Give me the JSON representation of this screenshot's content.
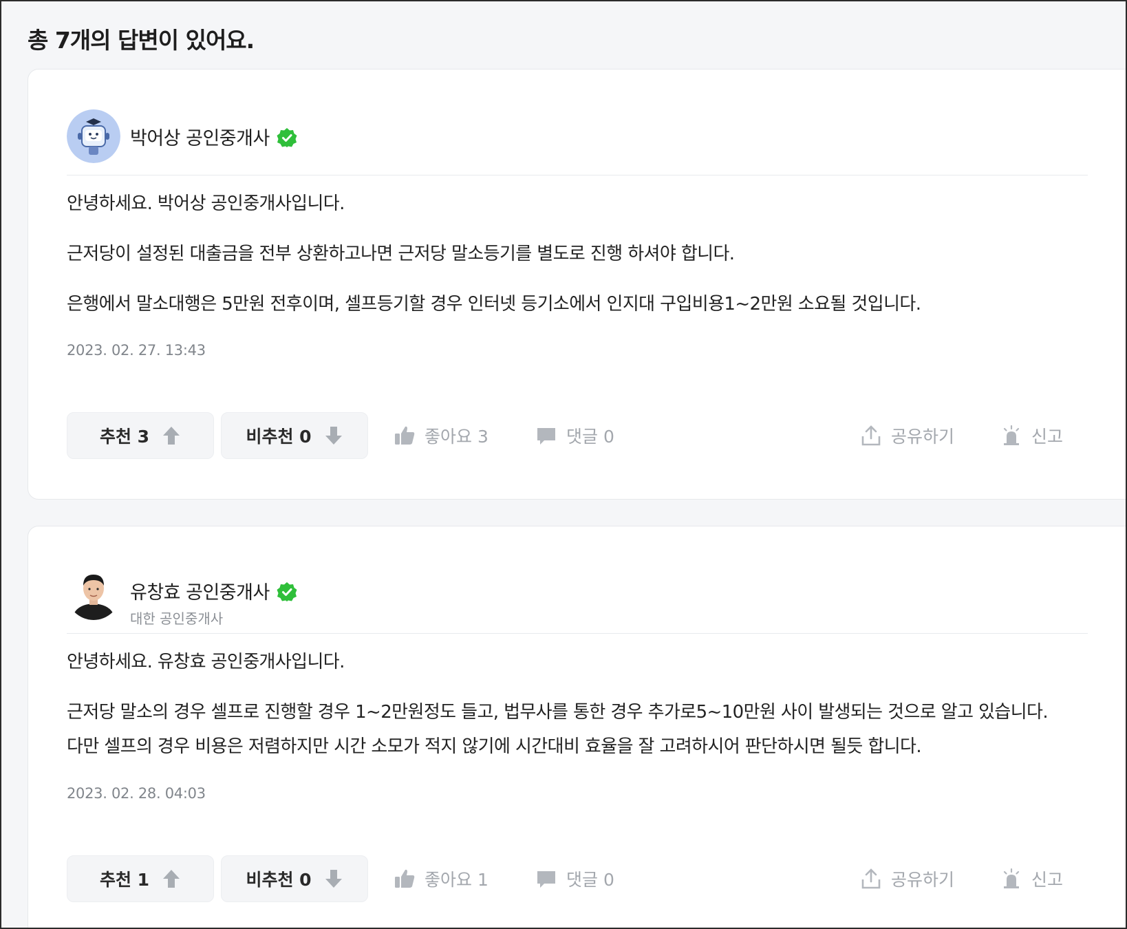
{
  "header": {
    "title": "총 7개의 답변이 있어요."
  },
  "answers": [
    {
      "author": {
        "name": "박어상 공인중개사",
        "subtitle": ""
      },
      "paragraphs": [
        "안녕하세요. 박어상 공인중개사입니다.",
        "근저당이 설정된 대출금을 전부 상환하고나면 근저당 말소등기를 별도로 진행 하셔야 합니다.",
        "은행에서 말소대행은 5만원 전후이며, 셀프등기할 경우 인터넷 등기소에서 인지대 구입비용1~2만원 소요될 것입니다."
      ],
      "date": "2023. 02. 27. 13:43",
      "actions": {
        "upvote": "추천 3",
        "downvote": "비추천 0",
        "like": "좋아요 3",
        "comment": "댓글 0",
        "share": "공유하기",
        "report": "신고"
      }
    },
    {
      "author": {
        "name": "유창효 공인중개사",
        "subtitle": "대한 공인중개사"
      },
      "paragraphs": [
        "안녕하세요. 유창효 공인중개사입니다.",
        "근저당 말소의 경우 셀프로 진행할 경우 1~2만원정도 들고, 법무사를 통한 경우 추가로5~10만원 사이 발생되는 것으로 알고 있습니다.",
        "다만 셀프의 경우 비용은 저렴하지만 시간 소모가 적지 않기에 시간대비 효율을 잘 고려하시어 판단하시면 될듯 합니다."
      ],
      "date": "2023. 02. 28. 04:03",
      "actions": {
        "upvote": "추천 1",
        "downvote": "비추천 0",
        "like": "좋아요 1",
        "comment": "댓글 0",
        "share": "공유하기",
        "report": "신고"
      }
    }
  ],
  "colors": {
    "verified": "#2fbf3a",
    "accent_text": "#222222",
    "muted": "#a3a7ad"
  }
}
